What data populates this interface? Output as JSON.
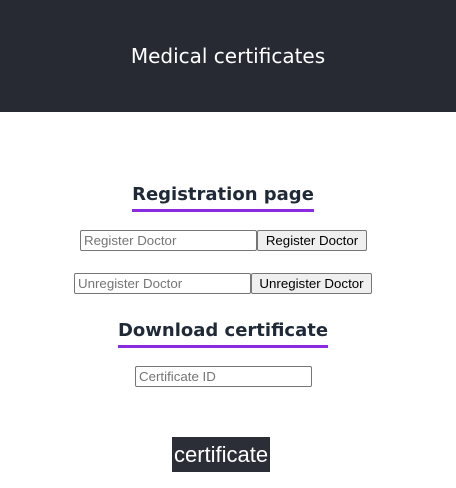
{
  "header": {
    "title": "Medical certificates"
  },
  "registration": {
    "title": "Registration page",
    "register_placeholder": "Register Doctor",
    "register_button": "Register Doctor",
    "unregister_placeholder": "Unregister Doctor",
    "unregister_button": "Unregister Doctor"
  },
  "download": {
    "title": "Download certificate",
    "certificate_id_placeholder": "Certificate ID",
    "certificate_button": "certificate"
  },
  "colors": {
    "header_bg": "#272a33",
    "accent_underline": "#8a2be2"
  }
}
